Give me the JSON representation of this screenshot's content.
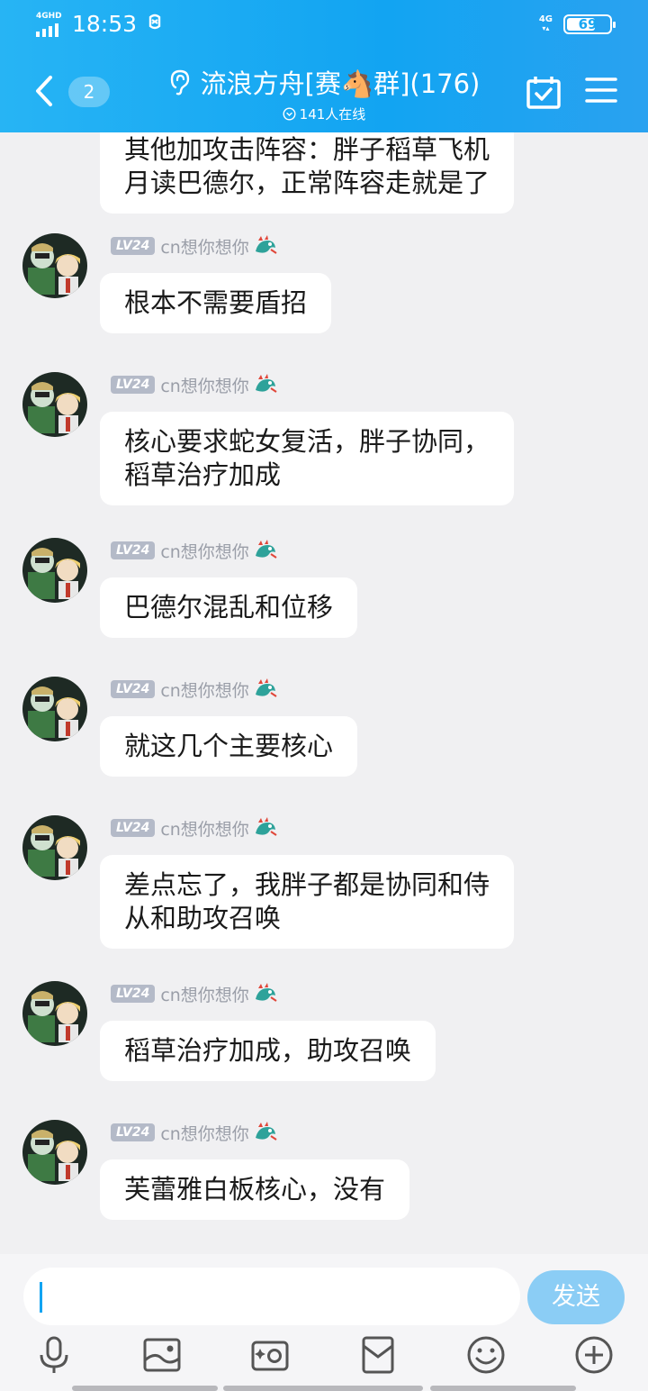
{
  "status_bar": {
    "network_label": "4GHD",
    "time": "18:53",
    "app_icon": "soul-app-icon",
    "net_right": "4G",
    "battery": "69",
    "battery_level": 0.69
  },
  "header": {
    "back_icon": "chevron-left-icon",
    "unread_count": "2",
    "title": "流浪方舟[赛🐴群](176)",
    "online_text": "141人在线",
    "calendar_icon": "calendar-check-icon",
    "menu_icon": "menu-icon"
  },
  "messages": [
    {
      "text_lines": [
        "其他加攻击阵容：胖子稻草飞机",
        "月读巴德尔，正常阵容走就是了"
      ]
    },
    {
      "level": "LV24",
      "name": "cn想你想你",
      "text_lines": [
        "根本不需要盾招"
      ]
    },
    {
      "level": "LV24",
      "name": "cn想你想你",
      "text_lines": [
        "核心要求蛇女复活，胖子协同，",
        "稻草治疗加成"
      ]
    },
    {
      "level": "LV24",
      "name": "cn想你想你",
      "text_lines": [
        "巴德尔混乱和位移"
      ]
    },
    {
      "level": "LV24",
      "name": "cn想你想你",
      "text_lines": [
        "就这几个主要核心"
      ]
    },
    {
      "level": "LV24",
      "name": "cn想你想你",
      "text_lines": [
        "差点忘了，我胖子都是协同和侍",
        "从和助攻召唤"
      ]
    },
    {
      "level": "LV24",
      "name": "cn想你想你",
      "text_lines": [
        "稻草治疗加成，助攻召唤"
      ]
    },
    {
      "level": "LV24",
      "name": "cn想你想你",
      "text_lines": [
        "芙蕾雅白板核心，没有"
      ]
    }
  ],
  "input": {
    "value": "",
    "send_label": "发送"
  },
  "toolbar": [
    "microphone-icon",
    "image-icon",
    "camera-icon",
    "red-packet-icon",
    "emoji-icon",
    "plus-icon"
  ],
  "colors": {
    "header": "#12a4f2",
    "send_button": "#8bcdf5",
    "level_badge": "#b4bac8"
  }
}
